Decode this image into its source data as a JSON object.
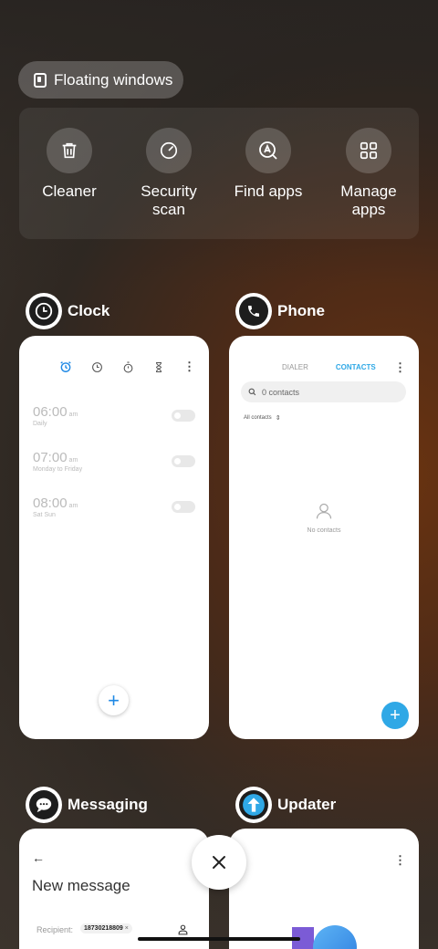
{
  "floating_windows": {
    "label": "Floating windows"
  },
  "tools": [
    {
      "label": "Cleaner",
      "icon": "trash-icon"
    },
    {
      "label": "Security\nscan",
      "icon": "security-scan-icon"
    },
    {
      "label": "Find apps",
      "icon": "find-apps-icon"
    },
    {
      "label": "Manage\napps",
      "icon": "grid-icon"
    }
  ],
  "apps": {
    "clock": {
      "name": "Clock",
      "alarms": [
        {
          "time": "06:00",
          "ampm": "am",
          "repeat": "Daily"
        },
        {
          "time": "07:00",
          "ampm": "am",
          "repeat": "Monday to Friday"
        },
        {
          "time": "08:00",
          "ampm": "am",
          "repeat": "Sat Sun"
        }
      ],
      "fab": "+"
    },
    "phone": {
      "name": "Phone",
      "tab_dialer": "DIALER",
      "tab_contacts": "CONTACTS",
      "search_placeholder": "0 contacts",
      "filter": "All contacts",
      "empty": "No contacts",
      "fab": "+"
    },
    "messaging": {
      "name": "Messaging",
      "title": "New message",
      "recipient_label": "Recipient:",
      "recipient_chip": "18730218809"
    },
    "updater": {
      "name": "Updater"
    }
  },
  "colors": {
    "accent_blue": "#1e88e5",
    "fab_blue": "#2fa8e6",
    "contacts_tab": "#2fa8e6"
  }
}
